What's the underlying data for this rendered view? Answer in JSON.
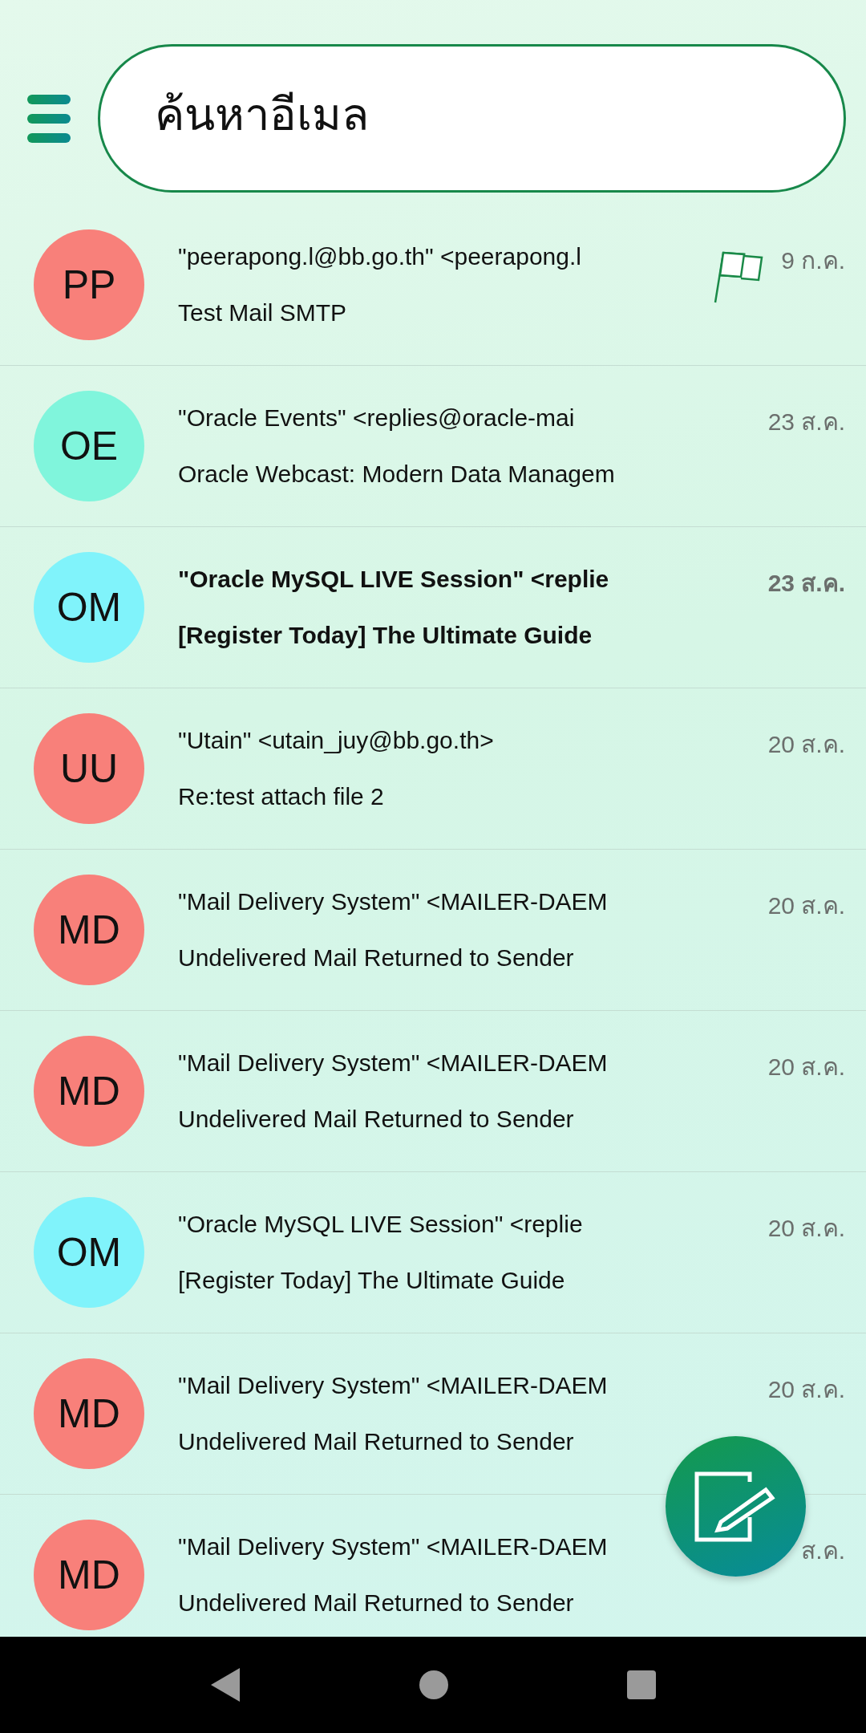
{
  "search": {
    "placeholder": "ค้นหาอีเมล"
  },
  "emails": [
    {
      "initials": "PP",
      "color": "#f8807a",
      "sender": "\"peerapong.l@bb.go.th\" <peerapong.l",
      "subject": "Test Mail SMTP",
      "date": "9 ก.ค.",
      "unread": false,
      "flagged": true
    },
    {
      "initials": "OE",
      "color": "#80f5dc",
      "sender": "\"Oracle Events\" <replies@oracle-mai",
      "subject": "Oracle Webcast: Modern Data Managem",
      "date": "23 ส.ค.",
      "unread": false,
      "flagged": false
    },
    {
      "initials": "OM",
      "color": "#80f3fb",
      "sender": "\"Oracle MySQL LIVE Session\" <replie",
      "subject": "[Register Today] The Ultimate Guide",
      "date": "23 ส.ค.",
      "unread": true,
      "flagged": false
    },
    {
      "initials": "UU",
      "color": "#f8807a",
      "sender": "\"Utain\" <utain_juy@bb.go.th>",
      "subject": "Re:test attach file 2",
      "date": "20 ส.ค.",
      "unread": false,
      "flagged": false
    },
    {
      "initials": "MD",
      "color": "#f8807a",
      "sender": "\"Mail Delivery System\" <MAILER-DAEM",
      "subject": "Undelivered Mail Returned to Sender",
      "date": "20 ส.ค.",
      "unread": false,
      "flagged": false
    },
    {
      "initials": "MD",
      "color": "#f8807a",
      "sender": "\"Mail Delivery System\" <MAILER-DAEM",
      "subject": "Undelivered Mail Returned to Sender",
      "date": "20 ส.ค.",
      "unread": false,
      "flagged": false
    },
    {
      "initials": "OM",
      "color": "#80f3fb",
      "sender": "\"Oracle MySQL LIVE Session\" <replie",
      "subject": "[Register Today] The Ultimate Guide",
      "date": "20 ส.ค.",
      "unread": false,
      "flagged": false
    },
    {
      "initials": "MD",
      "color": "#f8807a",
      "sender": "\"Mail Delivery System\" <MAILER-DAEM",
      "subject": "Undelivered Mail Returned to Sender",
      "date": "20 ส.ค.",
      "unread": false,
      "flagged": false
    },
    {
      "initials": "MD",
      "color": "#f8807a",
      "sender": "\"Mail Delivery System\" <MAILER-DAEM",
      "subject": "Undelivered Mail Returned to Sender",
      "date": "ส.ค.",
      "unread": false,
      "flagged": false
    }
  ]
}
